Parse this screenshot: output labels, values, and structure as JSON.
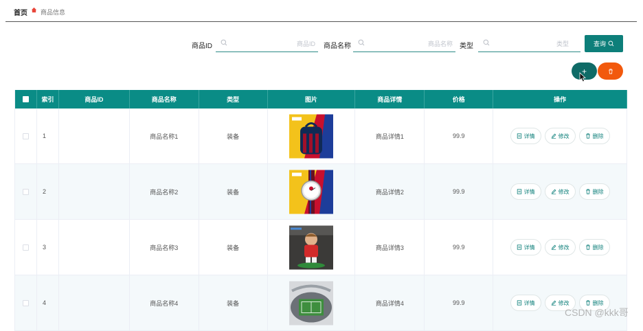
{
  "breadcrumb": {
    "home": "首页",
    "current": "商品信息",
    "icon": "home-icon"
  },
  "search": {
    "fields": [
      {
        "label": "商品ID",
        "placeholder": "商品ID",
        "value": ""
      },
      {
        "label": "商品名称",
        "placeholder": "商品名称",
        "value": ""
      },
      {
        "label": "类型",
        "placeholder": "类型",
        "value": ""
      }
    ],
    "query_label": "查询"
  },
  "actions": {
    "add_symbol": "+",
    "delete_icon": "trash-icon"
  },
  "table": {
    "columns": [
      "索引",
      "商品ID",
      "商品名称",
      "类型",
      "图片",
      "商品详情",
      "价格",
      "操作"
    ],
    "rows": [
      {
        "index": "1",
        "id": "",
        "name": "商品名称1",
        "type": "装备",
        "image": "backpack-image",
        "detail": "商品详情1",
        "price": "99.9"
      },
      {
        "index": "2",
        "id": "",
        "name": "商品名称2",
        "type": "装备",
        "image": "watch-image",
        "detail": "商品详情2",
        "price": "99.9"
      },
      {
        "index": "3",
        "id": "",
        "name": "商品名称3",
        "type": "装备",
        "image": "figure-image",
        "detail": "商品详情3",
        "price": "99.9"
      },
      {
        "index": "4",
        "id": "",
        "name": "商品名称4",
        "type": "装备",
        "image": "stadium-image",
        "detail": "商品详情4",
        "price": "99.9"
      }
    ],
    "row_actions": {
      "detail": "详情",
      "edit": "修改",
      "delete": "删除"
    }
  },
  "watermark": "CSDN @kkk哥",
  "colors": {
    "primary": "#0a8c86",
    "danger": "#f2590d",
    "row_alt": "#f4f9fb"
  }
}
